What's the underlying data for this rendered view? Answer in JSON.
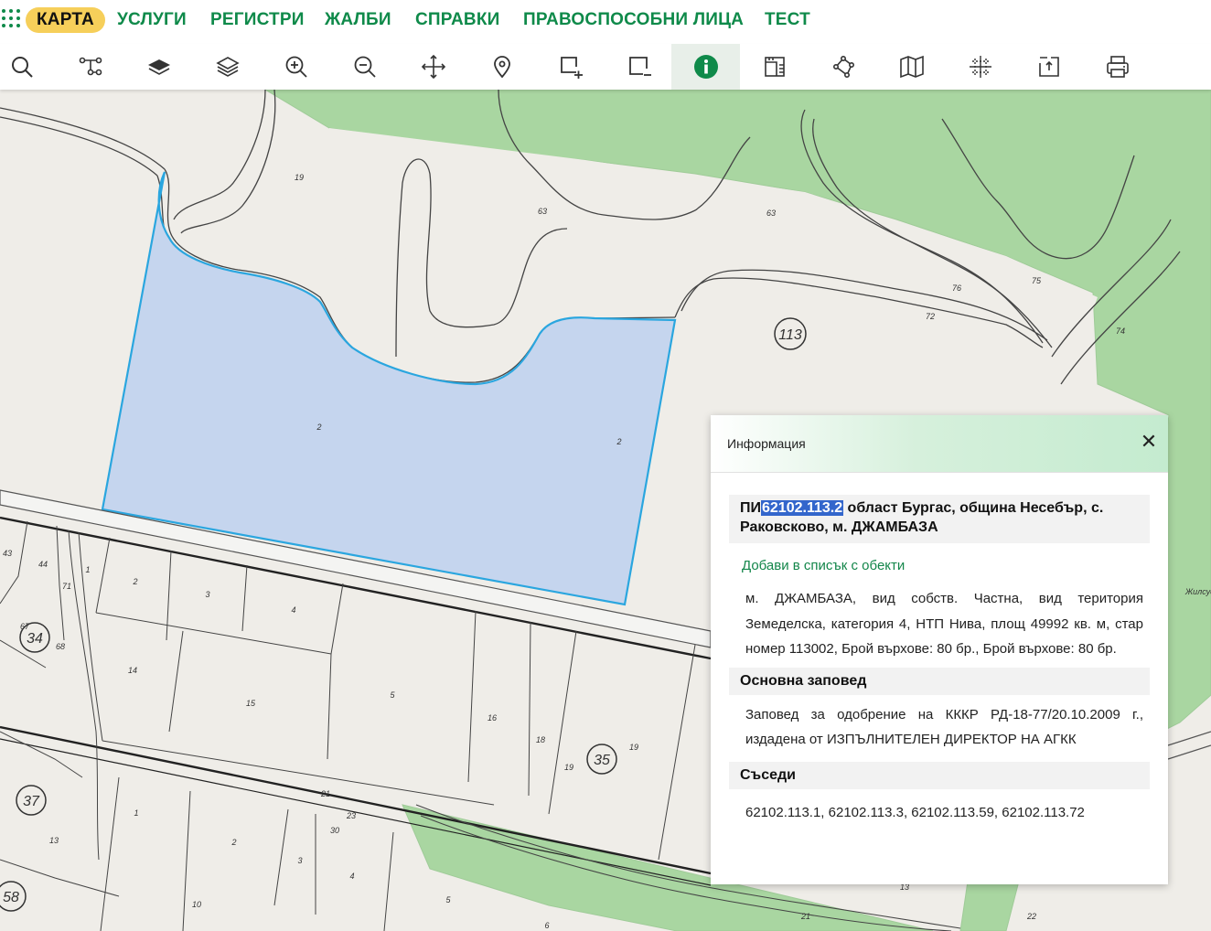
{
  "nav": {
    "items": [
      "КАРТА",
      "УСЛУГИ",
      "РЕГИСТРИ",
      "ЖАЛБИ",
      "СПРАВКИ",
      "ПРАВОСПОСОБНИ ЛИЦА",
      "ТЕСТ"
    ],
    "active": "КАРТА"
  },
  "toolbar": {
    "tools": [
      "search-icon",
      "route-icon",
      "layer-solid-icon",
      "layers-icon",
      "zoom-in-icon",
      "zoom-out-icon",
      "pan-icon",
      "location-pin-icon",
      "add-area-icon",
      "remove-area-icon",
      "info-icon",
      "ruler-icon",
      "polygon-icon",
      "map-icon",
      "coordinates-icon",
      "export-icon",
      "print-icon"
    ],
    "active": "info-icon"
  },
  "map": {
    "labels": {
      "road_label": "Жилсуе",
      "l19a": "19",
      "l63a": "63",
      "l63b": "63",
      "l75": "75",
      "l76": "76",
      "l72": "72",
      "l74": "74",
      "l2a": "2",
      "l2b": "2",
      "l43": "43",
      "l44": "44",
      "l71": "71",
      "l1a": "1",
      "l2c": "2",
      "l3a": "3",
      "l4a": "4",
      "l67": "67",
      "l68": "68",
      "l14": "14",
      "l15": "15",
      "l5a": "5",
      "l16": "16",
      "l18": "18",
      "l19b": "19",
      "l19c": "19",
      "l21a": "21",
      "l23": "23",
      "l30": "30",
      "l1b": "1",
      "l2d": "2",
      "l3b": "3",
      "l4b": "4",
      "l10": "10",
      "l5b": "5",
      "l6": "6",
      "l13a": "13",
      "l13b": "13",
      "l21b": "21",
      "l22": "22"
    },
    "circles": {
      "c113": "113",
      "c34": "34",
      "c35": "35",
      "c37": "37",
      "c58": "58"
    },
    "colors": {
      "forest": "#a8d5a0",
      "land": "#efede8",
      "selection_fill": "#c5d5ee",
      "selection_stroke": "#2aa6df"
    }
  },
  "info": {
    "header": "Информация",
    "close": "✕",
    "title_prefix": "ПИ",
    "title_id": "62102.113.2",
    "title_rest": " област Бургас, община Несебър, с. Раковсково, м. ДЖАМБАЗА",
    "add_link": "Добави в списък с обекти",
    "description": "м. ДЖАМБАЗА, вид собств. Частна, вид територия Земеделска, категория 4, НТП Нива, площ 49992 кв. м, стар номер 113002, Брой върхове: 80 бр., Брой върхове: 80 бр.",
    "order_title": "Основна заповед",
    "order_text": "Заповед за одобрение на КККР РД-18-77/20.10.2009 г., издадена от ИЗПЪЛНИТЕЛЕН ДИРЕКТОР НА АГКК",
    "neighbors_title": "Съседи",
    "neighbors": "62102.113.1, 62102.113.3, 62102.113.59, 62102.113.72"
  }
}
